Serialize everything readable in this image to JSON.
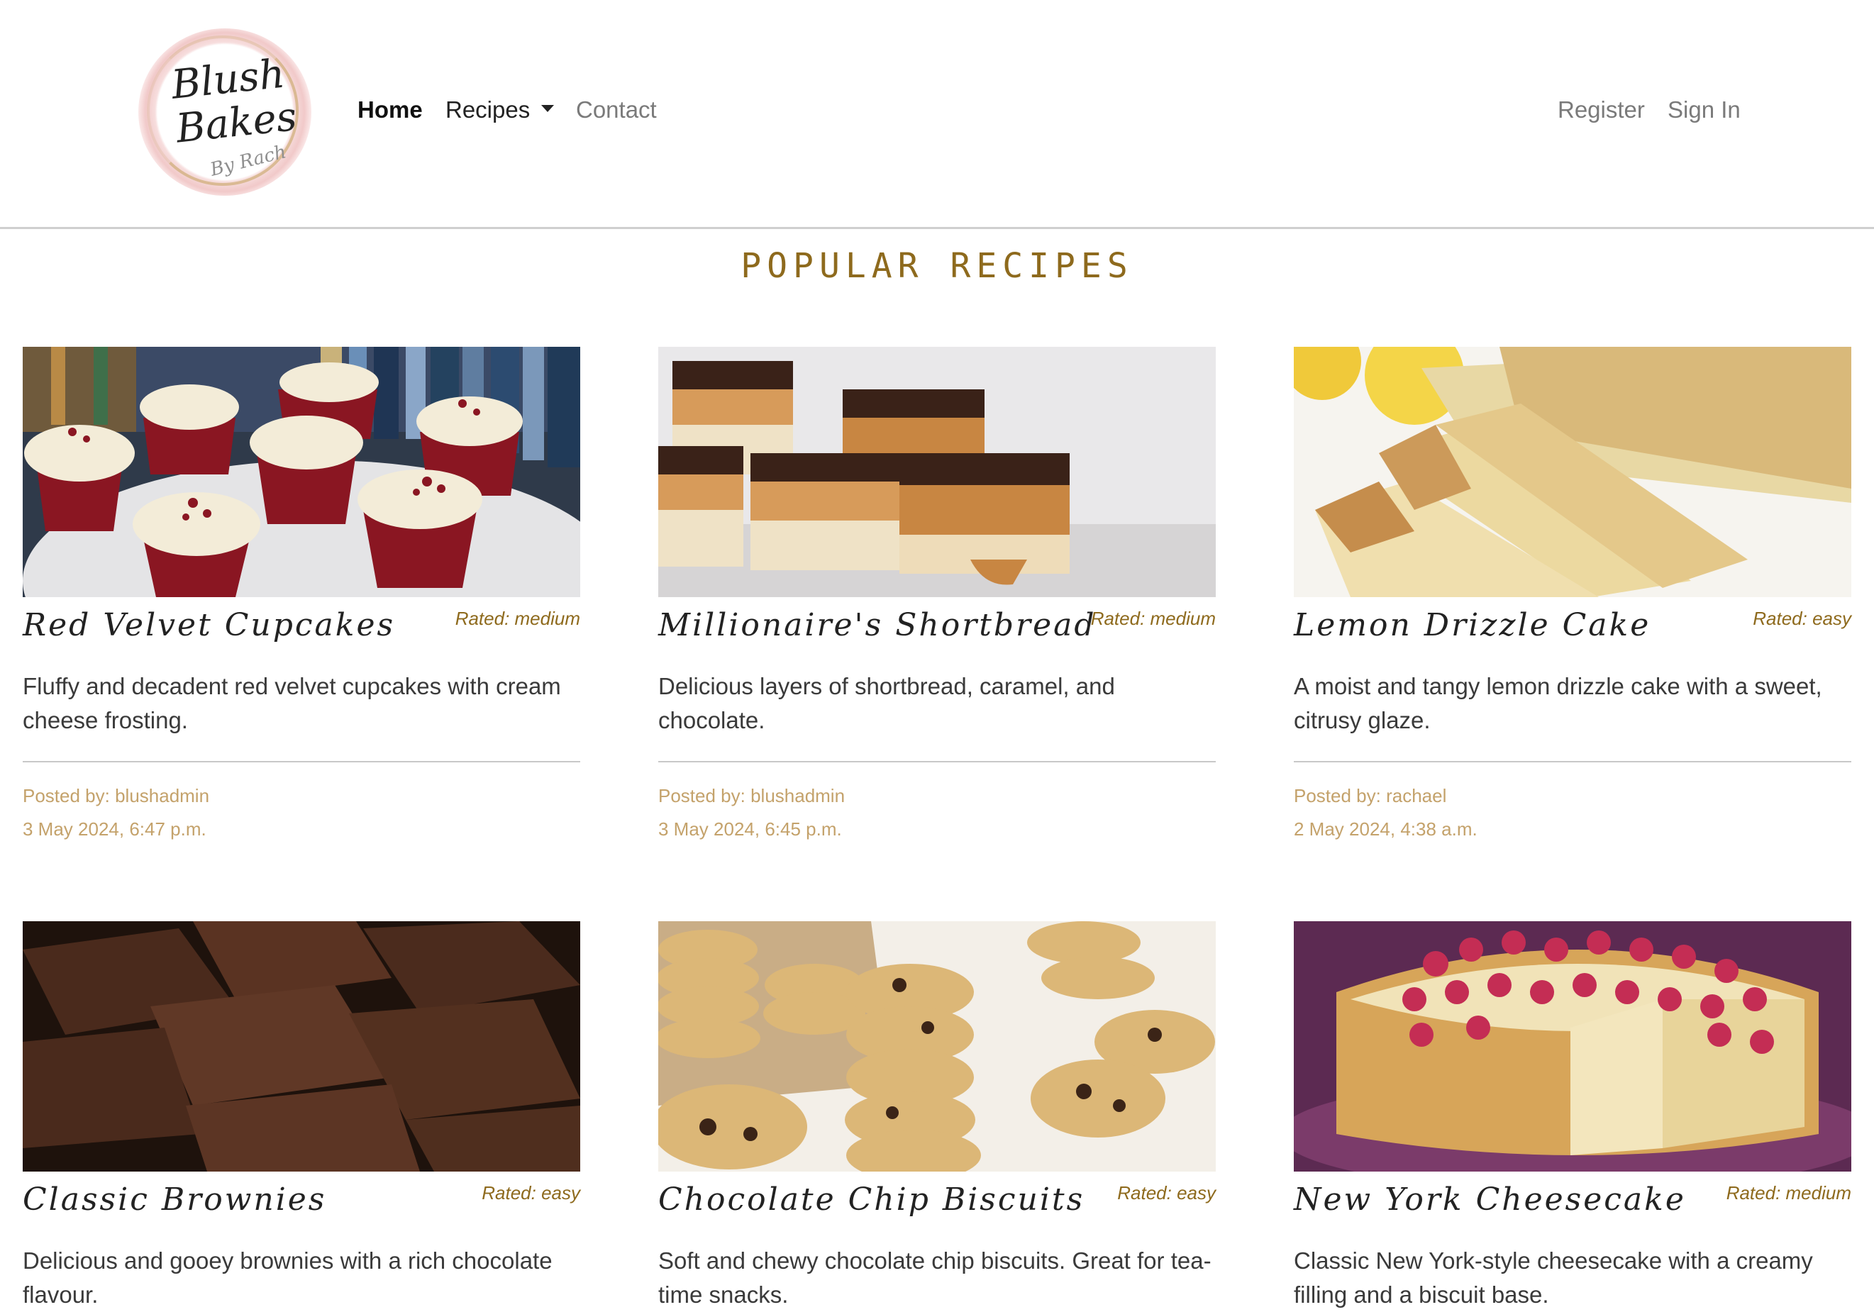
{
  "brand": {
    "logo_line1": "Blush",
    "logo_line2": "Bakes",
    "logo_sub": "By Rach"
  },
  "nav": {
    "home": "Home",
    "recipes": "Recipes",
    "contact": "Contact",
    "register": "Register",
    "sign_in": "Sign In"
  },
  "section": {
    "title": "Popular Recipes"
  },
  "recipes": [
    {
      "title": "Red Velvet Cupcakes",
      "rating": "Rated: medium",
      "description": "Fluffy and decadent red velvet cupcakes with cream cheese frosting.",
      "author": "Posted by: blushadmin",
      "date": "3 May 2024, 6:47 p.m."
    },
    {
      "title": "Millionaire's Shortbread",
      "rating": "Rated: medium",
      "description": "Delicious layers of shortbread, caramel, and chocolate.",
      "author": "Posted by: blushadmin",
      "date": "3 May 2024, 6:45 p.m."
    },
    {
      "title": "Lemon Drizzle Cake",
      "rating": "Rated: easy",
      "description": "A moist and tangy lemon drizzle cake with a sweet, citrusy glaze.",
      "author": "Posted by: rachael",
      "date": "2 May 2024, 4:38 a.m."
    },
    {
      "title": "Classic Brownies",
      "rating": "Rated: easy",
      "description": "Delicious and gooey brownies with a rich chocolate flavour."
    },
    {
      "title": "Chocolate Chip Biscuits",
      "rating": "Rated: easy",
      "description": "Soft and chewy chocolate chip biscuits. Great for tea-time snacks."
    },
    {
      "title": "New York Cheesecake",
      "rating": "Rated: medium",
      "description": "Classic New York-style cheesecake with a creamy filling and a biscuit base."
    }
  ],
  "colors": {
    "accent": "#8e6a1d",
    "meta": "#c4a26b",
    "nav_muted": "#7a7a7a"
  }
}
